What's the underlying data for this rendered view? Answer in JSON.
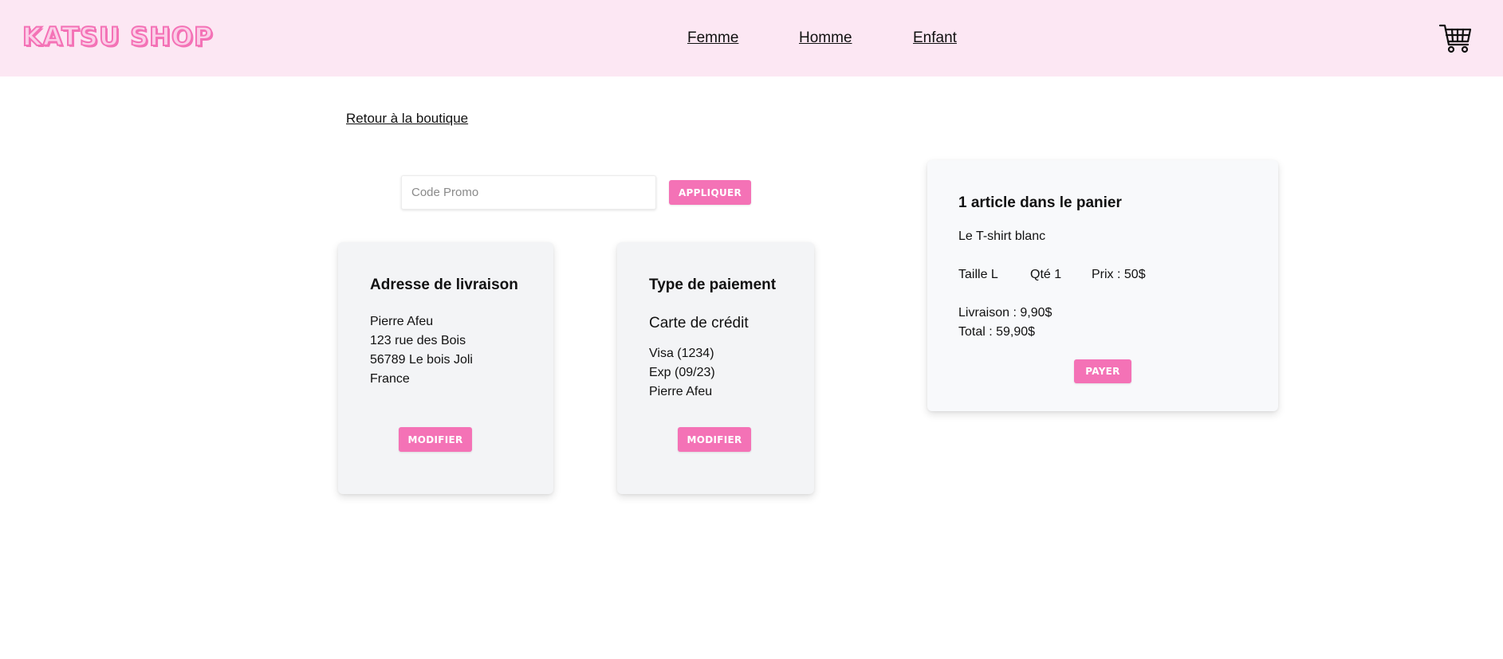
{
  "header": {
    "logo": "KATSU SHOP",
    "nav": [
      "Femme",
      "Homme",
      "Enfant"
    ],
    "cart_icon": "shopping-cart-icon"
  },
  "back_link": "Retour à la boutique",
  "promo": {
    "placeholder": "Code Promo",
    "value": "",
    "apply_label": "APPLIQUER"
  },
  "address": {
    "title": "Adresse de livraison",
    "lines": [
      "Pierre Afeu",
      "123 rue des Bois",
      "56789 Le bois Joli",
      "France"
    ],
    "button": "MODIFIER"
  },
  "payment": {
    "title": "Type de paiement",
    "method": "Carte de crédit",
    "lines": [
      "Visa (1234)",
      "Exp (09/23)",
      "Pierre Afeu"
    ],
    "button": "MODIFIER"
  },
  "summary": {
    "title": "1 article dans le panier",
    "item_name": "Le T-shirt blanc",
    "size": "Taille L",
    "qty": "Qté 1",
    "price": "Prix : 50$",
    "shipping": "Livraison : 9,90$",
    "total": "Total : 59,90$",
    "pay_label": "PAYER"
  },
  "colors": {
    "header_bg": "#fce7f3",
    "accent": "#f472b6",
    "card_bg": "#f3f4f6"
  }
}
